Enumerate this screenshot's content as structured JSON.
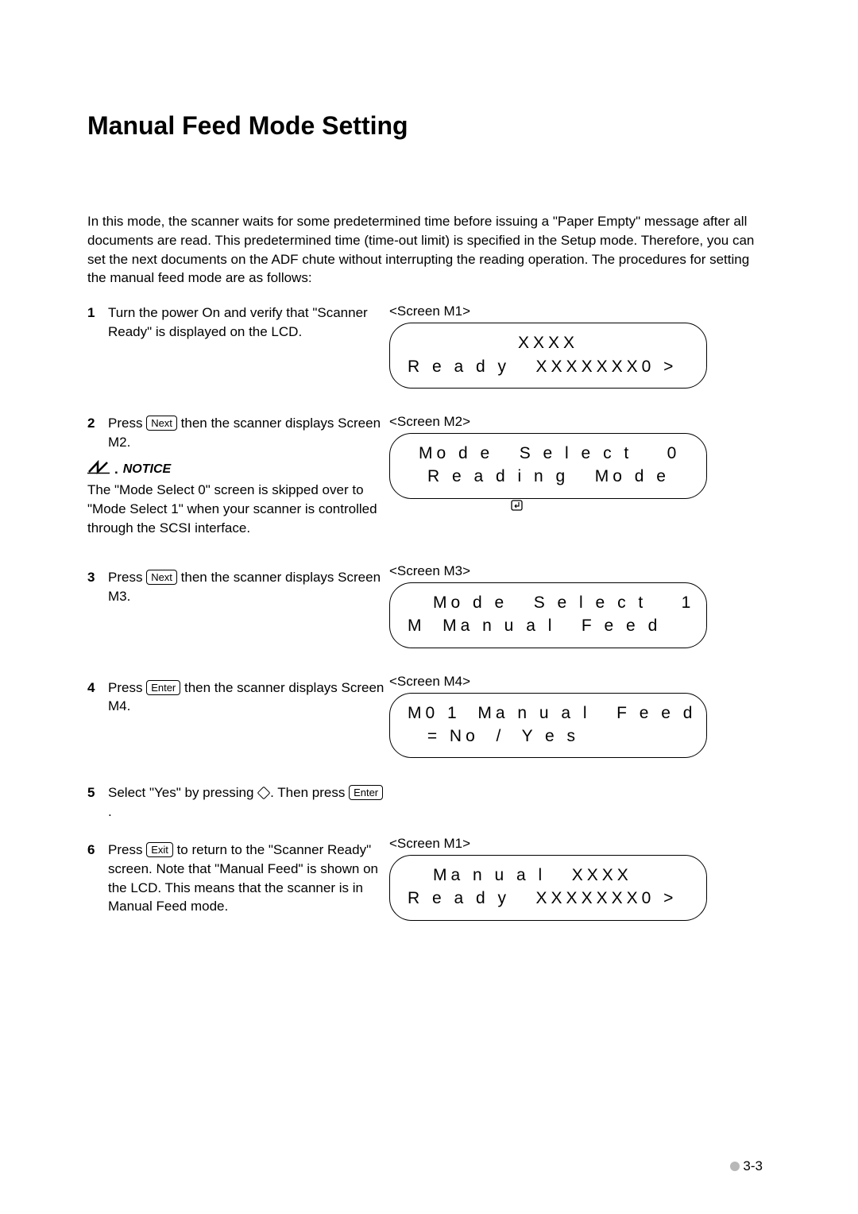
{
  "heading": "Manual Feed Mode Setting",
  "intro": "In this mode, the scanner waits for some predetermined time before issuing a \"Paper Empty\" message after all documents are read. This predetermined time (time-out limit) is specified in the Setup mode. Therefore, you can set the next documents on the ADF chute without interrupting the reading operation. The procedures for setting the manual feed mode are as follows:",
  "keys": {
    "next": "Next",
    "enter": "Enter",
    "exit": "Exit"
  },
  "steps": {
    "s1": {
      "num": "1",
      "text": "Turn the power On and verify that \"Scanner Ready\" is displayed on the LCD."
    },
    "s2": {
      "num": "2",
      "before": "Press ",
      "after": " then the scanner displays Screen M2."
    },
    "s3": {
      "num": "3",
      "before": "Press ",
      "after": " then the scanner displays Screen M3."
    },
    "s4": {
      "num": "4",
      "before": "Press ",
      "after": " then the scanner displays Screen M4."
    },
    "s5": {
      "num": "5",
      "before": "Select \"Yes\" by pressing ",
      "after": ". Then press "
    },
    "s6": {
      "num": "6",
      "before": "Press ",
      "after": " to return to the \"Scanner Ready\" screen. Note that \"Manual Feed\" is shown on the LCD. This means that the scanner is in Manual Feed mode."
    }
  },
  "notice": {
    "label": "NOTICE",
    "text": "The \"Mode Select 0\" screen is skipped over to \"Mode Select 1\" when your scanner is controlled through the SCSI interface."
  },
  "screens": {
    "m1": {
      "label": "<Screen M1>",
      "line1": "XXXX",
      "line2": "R e a d y   XXXXXXX0 >"
    },
    "m2": {
      "label": "<Screen M2>",
      "line1": "Mo d e   S e l e c t    0",
      "line2": "R e a d i n g   Mo d e"
    },
    "m3": {
      "label": "<Screen M3>",
      "line1": "Mo d e   S e l e c t    1",
      "line2": "M  Ma n u a l   F e e d"
    },
    "m4": {
      "label": "<Screen M4>",
      "line1": "M0 1  Ma n u a l   F e e d",
      "line2": " = No  /  Y e s"
    },
    "m1b": {
      "label": "<Screen M1>",
      "line1": "Ma n u a l   XXXX",
      "line2": "R e a d y   XXXXXXX0 >"
    }
  },
  "pageNum": "3-3"
}
